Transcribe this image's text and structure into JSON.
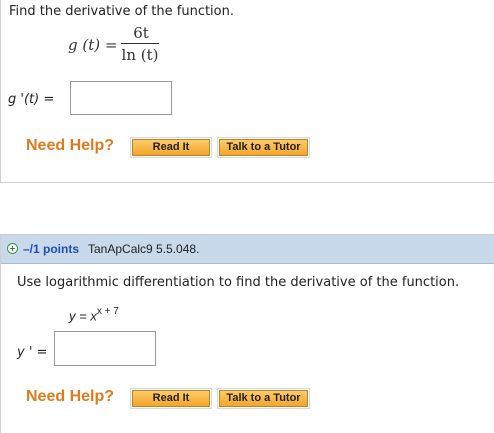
{
  "q1": {
    "prompt": "Find the derivative of the function.",
    "lhs": "g (t) =",
    "numerator": "6t",
    "denominator": "ln (t)",
    "answer_label": "g '(t) =",
    "answer_value": "",
    "need_help": "Need Help?",
    "read_it": "Read It",
    "talk_tutor": "Talk to a Tutor"
  },
  "q2": {
    "points": "–/1 points",
    "source": "TanApCalc9 5.5.048.",
    "prompt": "Use logarithmic differentiation to find the derivative of the function.",
    "eq_lhs": "y = x",
    "eq_exp": "x + 7",
    "answer_label": "y ' =",
    "answer_value": "",
    "need_help": "Need Help?",
    "read_it": "Read It",
    "talk_tutor": "Talk to a Tutor"
  },
  "colors": {
    "need_help": "#e07a1f",
    "button": "#f3a62a",
    "header": "#c7d9ea",
    "points": "#1f4fb0"
  },
  "icons": {
    "expand": "plus-circle-icon"
  }
}
